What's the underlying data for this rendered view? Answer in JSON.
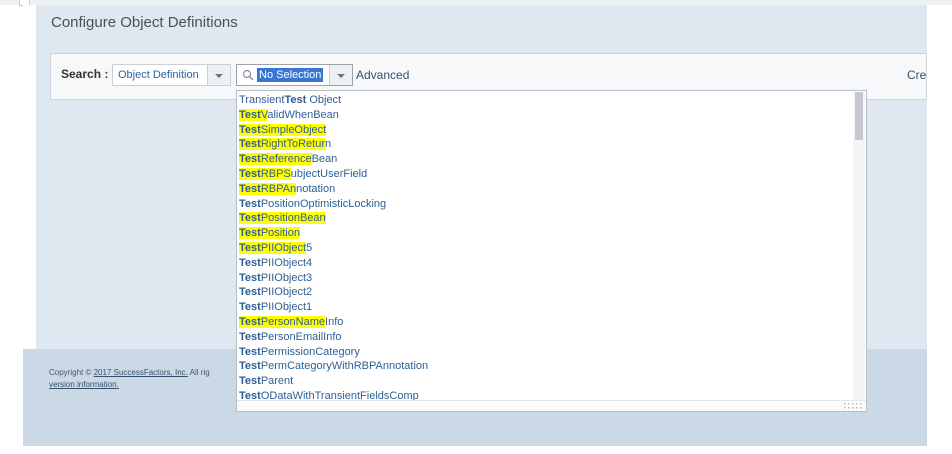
{
  "page": {
    "title": "Configure Object Definitions"
  },
  "search": {
    "label": "Search :",
    "type_value": "Object Definition",
    "combo_value": "No Selection",
    "advanced_label": "Advanced",
    "create_label": "Cre"
  },
  "footer": {
    "copyright_prefix": "Copyright ©",
    "copyright_link": "2017 SuccessFactors, Inc.",
    "copyright_suffix": "All rig",
    "version_link": "version information."
  },
  "dropdown": {
    "items": [
      {
        "pre": "Transient",
        "bold": "Test",
        "hl": "",
        "rest": " Object"
      },
      {
        "pre": "",
        "bold": "Test",
        "hl": "V",
        "rest": "alidWhenBean"
      },
      {
        "pre": "",
        "bold": "Test",
        "hl": "SimpleObject",
        "rest": ""
      },
      {
        "pre": "",
        "bold": "Test",
        "hl": "RightToRetur",
        "rest": "n"
      },
      {
        "pre": "",
        "bold": "Test",
        "hl": "Reference",
        "rest": "Bean"
      },
      {
        "pre": "",
        "bold": "Test",
        "hl": "RBPS",
        "rest": "ubjectUserField"
      },
      {
        "pre": "",
        "bold": "Test",
        "hl": "RBPAn",
        "rest": "notation"
      },
      {
        "pre": "",
        "bold": "Test",
        "hl": "",
        "rest": "PositionOptimisticLocking"
      },
      {
        "pre": "",
        "bold": "Test",
        "hl": "PositionBean",
        "rest": ""
      },
      {
        "pre": "",
        "bold": "Test",
        "hl": "Position",
        "rest": ""
      },
      {
        "pre": "",
        "bold": "Test",
        "hl": "PIIObject",
        "rest": "5"
      },
      {
        "pre": "",
        "bold": "Test",
        "hl": "",
        "rest": "PIIObject4"
      },
      {
        "pre": "",
        "bold": "Test",
        "hl": "",
        "rest": "PIIObject3"
      },
      {
        "pre": "",
        "bold": "Test",
        "hl": "",
        "rest": "PIIObject2"
      },
      {
        "pre": "",
        "bold": "Test",
        "hl": "",
        "rest": "PIIObject1"
      },
      {
        "pre": "",
        "bold": "Test",
        "hl": "PersonName",
        "rest": "Info"
      },
      {
        "pre": "",
        "bold": "Test",
        "hl": "",
        "rest": "PersonEmailInfo"
      },
      {
        "pre": "",
        "bold": "Test",
        "hl": "",
        "rest": "PermissionCategory"
      },
      {
        "pre": "",
        "bold": "Test",
        "hl": "",
        "rest": "PermCategoryWithRBPAnnotation"
      },
      {
        "pre": "",
        "bold": "Test",
        "hl": "",
        "rest": "Parent"
      },
      {
        "pre": "",
        "bold": "Test",
        "hl": "",
        "rest": "ODataWithTransientFieldsComp"
      }
    ]
  },
  "colors": {
    "highlight": "#ffff00",
    "selection": "#3876d6",
    "link": "#2e5f94"
  },
  "icons": {
    "combo": "search-icon",
    "arrows": "chevron-down-icon"
  }
}
